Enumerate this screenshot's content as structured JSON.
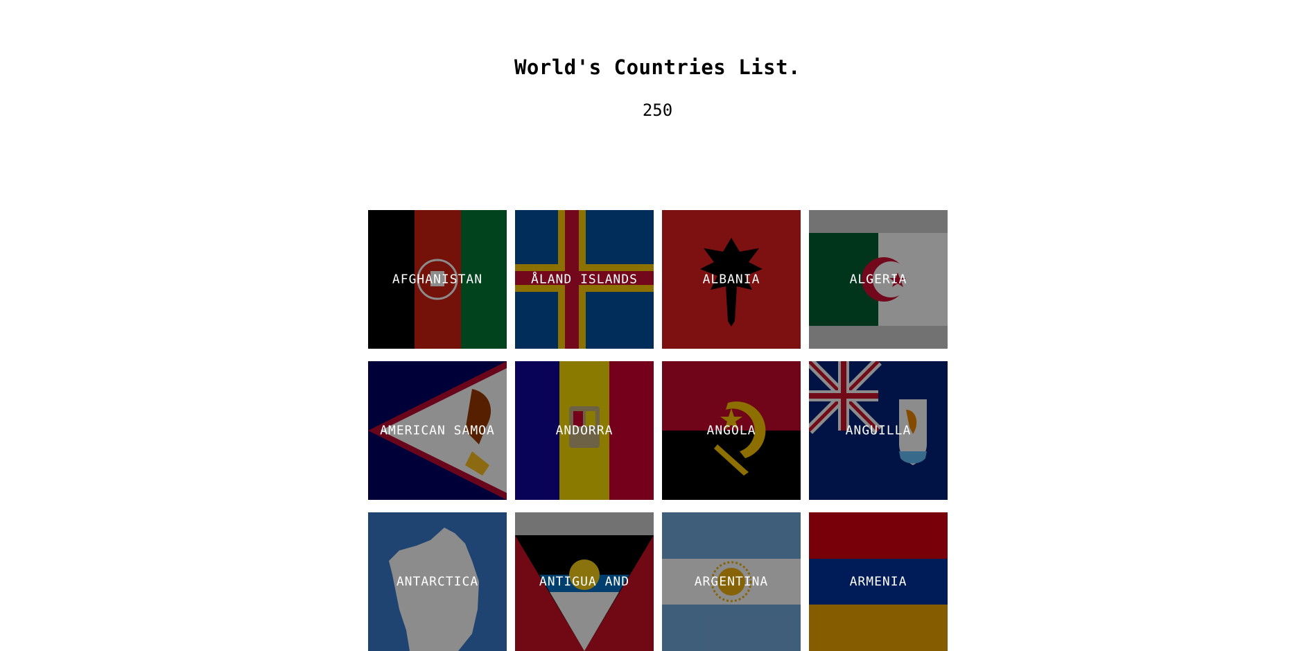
{
  "header": {
    "title": "World's Countries List.",
    "count": "250"
  },
  "countries": [
    {
      "name": "Afghanistan",
      "flag": "afghanistan-flag"
    },
    {
      "name": "Åland Islands",
      "flag": "aland-flag"
    },
    {
      "name": "Albania",
      "flag": "albania-flag"
    },
    {
      "name": "Algeria",
      "flag": "algeria-flag"
    },
    {
      "name": "American Samoa",
      "flag": "american-samoa-flag"
    },
    {
      "name": "Andorra",
      "flag": "andorra-flag"
    },
    {
      "name": "Angola",
      "flag": "angola-flag"
    },
    {
      "name": "Anguilla",
      "flag": "anguilla-flag"
    },
    {
      "name": "Antarctica",
      "flag": "antarctica-flag"
    },
    {
      "name": "Antigua and",
      "flag": "antigua-flag"
    },
    {
      "name": "Argentina",
      "flag": "argentina-flag"
    },
    {
      "name": "Armenia",
      "flag": "armenia-flag"
    }
  ]
}
